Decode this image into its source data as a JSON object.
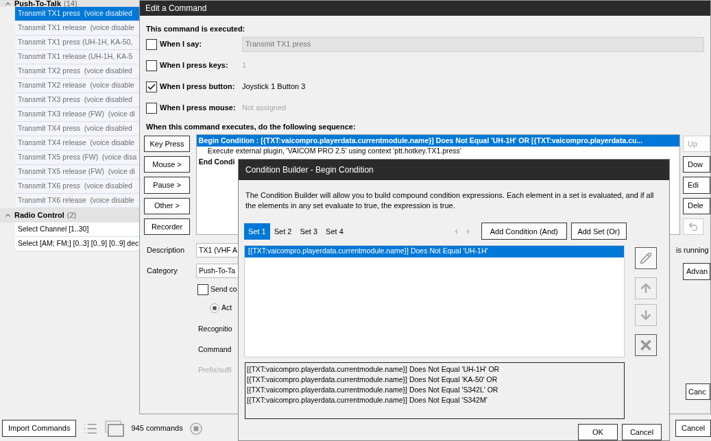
{
  "main_window": {
    "groups": [
      {
        "title": "Push-To-Talk",
        "count": "(14)",
        "expanded": true,
        "items": [
          {
            "label": "Transmit TX1 press  (voice disabled",
            "selected": true,
            "disabled": true
          },
          {
            "label": "Transmit TX1 release  (voice disable",
            "selected": false,
            "disabled": true
          },
          {
            "label": "Transmit TX1 press (UH-1H, KA-50,",
            "selected": false,
            "disabled": true
          },
          {
            "label": "Transmit TX1 release (UH-1H, KA-5",
            "selected": false,
            "disabled": true
          },
          {
            "label": "Transmit TX2 press  (voice disabled",
            "selected": false,
            "disabled": true
          },
          {
            "label": "Transmit TX2 release  (voice disable",
            "selected": false,
            "disabled": true
          },
          {
            "label": "Transmit TX3 press  (voice disabled",
            "selected": false,
            "disabled": true
          },
          {
            "label": "Transmit TX3 release (FW)  (voice di",
            "selected": false,
            "disabled": true
          },
          {
            "label": "Transmit TX4 press  (voice disabled",
            "selected": false,
            "disabled": true
          },
          {
            "label": "Transmit TX4 release  (voice disable",
            "selected": false,
            "disabled": true
          },
          {
            "label": "Transmit TX5 press (FW)  (voice disa",
            "selected": false,
            "disabled": true
          },
          {
            "label": "Transmit TX5 release (FW)  (voice di",
            "selected": false,
            "disabled": true
          },
          {
            "label": "Transmit TX6 press  (voice disabled",
            "selected": false,
            "disabled": true
          },
          {
            "label": "Transmit TX6 release  (voice disable",
            "selected": false,
            "disabled": true
          }
        ]
      },
      {
        "title": "Radio Control",
        "count": "(2)",
        "expanded": true,
        "items": [
          {
            "label": "Select Channel [1..30]",
            "selected": false,
            "disabled": false
          },
          {
            "label": "Select [AM; FM;] [0..3] [0..9] [0..9] dec",
            "selected": false,
            "disabled": false
          }
        ]
      }
    ],
    "footer": {
      "import_button": "Import Commands",
      "command_count": "945 commands",
      "cancel_button": "Cancel"
    }
  },
  "edit_dialog": {
    "title": "Edit a Command",
    "triggers_heading": "This command is executed:",
    "triggers": [
      {
        "label": "When I say:",
        "checked": false,
        "kind": "field",
        "value": "Transmit TX1 press",
        "disabled": true
      },
      {
        "label": "When I press keys:",
        "checked": false,
        "kind": "text",
        "value": "1",
        "disabled": true
      },
      {
        "label": "When I press button:",
        "checked": true,
        "kind": "text",
        "value": "Joystick 1 Button 3",
        "disabled": false
      },
      {
        "label": "When I press mouse:",
        "checked": false,
        "kind": "text",
        "value": "Not assigned",
        "disabled": true
      }
    ],
    "sequence_heading": "When this command executes, do the following sequence:",
    "action_buttons": [
      "Key Press",
      "Mouse >",
      "Pause >",
      "Other >",
      "Recorder"
    ],
    "steps": [
      {
        "text": "Begin Condition : [{TXT:vaicompro.playerdata.currentmodule.name}] Does Not Equal 'UH-1H' OR [{TXT:vaicompro.playerdata.cu...",
        "selected": true,
        "children": [
          {
            "text": "Execute external plugin, 'VAICOM PRO 2.5' using context 'ptt.hotkey.TX1.press'",
            "selected": false
          }
        ]
      },
      {
        "text": "End Condi",
        "selected": false
      }
    ],
    "side_buttons": [
      {
        "label": "Up",
        "disabled": true
      },
      {
        "label": "Dow",
        "disabled": false
      },
      {
        "label": "Edi",
        "disabled": false
      },
      {
        "label": "Dele",
        "disabled": false
      }
    ],
    "description": {
      "label": "Description",
      "value": "TX1 (VHF A"
    },
    "category": {
      "label": "Category",
      "value": "Push-To-Ta"
    },
    "send_option": {
      "label": "Send co",
      "checked": false
    },
    "mode_option": {
      "label": "Act",
      "selected": true
    },
    "labels": [
      {
        "text": "Recognitio",
        "disabled": false
      },
      {
        "text": "Command",
        "disabled": false
      },
      {
        "text": "Prefix/suffi",
        "disabled": true
      }
    ],
    "running_note": "is running",
    "advanced_button": "Advan",
    "cancel_button": "Canc"
  },
  "condition_builder": {
    "title": "Condition Builder - Begin Condition",
    "intro": "The Condition Builder will allow you to build compound condition expressions.  Each element in a set is evaluated, and if all the elements in any set evaluate to true, the expression is true.",
    "tabs": [
      {
        "label": "Set 1",
        "selected": true
      },
      {
        "label": "Set 2",
        "selected": false
      },
      {
        "label": "Set 3",
        "selected": false
      },
      {
        "label": "Set 4",
        "selected": false
      }
    ],
    "add_condition_button": "Add Condition (And)",
    "add_set_button": "Add Set (Or)",
    "conditions": [
      {
        "text": "[{TXT:vaicompro.playerdata.currentmodule.name}] Does Not Equal 'UH-1H'",
        "selected": true
      }
    ],
    "summary": [
      "[{TXT:vaicompro.playerdata.currentmodule.name}] Does Not Equal 'UH-1H' OR",
      "[{TXT:vaicompro.playerdata.currentmodule.name}] Does Not Equal 'KA-50' OR",
      "[{TXT:vaicompro.playerdata.currentmodule.name}] Does Not Equal 'S342L' OR",
      "[{TXT:vaicompro.playerdata.currentmodule.name}] Does Not Equal 'S342M'"
    ],
    "ok_button": "OK",
    "cancel_button": "Cancel"
  }
}
